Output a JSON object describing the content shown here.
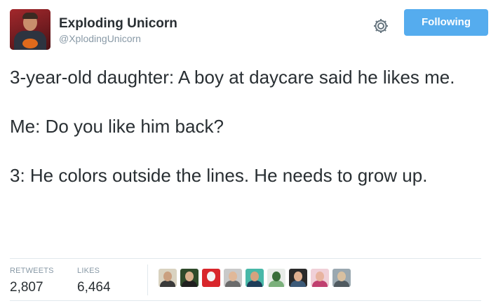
{
  "user": {
    "display_name": "Exploding Unicorn",
    "handle": "@XplodingUnicorn"
  },
  "actions": {
    "follow_label": "Following"
  },
  "tweet": {
    "lines": [
      "3-year-old daughter: A boy at daycare said he likes me.",
      "Me: Do you like him back?",
      "3: He colors outside the lines. He needs to grow up."
    ]
  },
  "stats": {
    "retweets_label": "RETWEETS",
    "retweets_value": "2,807",
    "likes_label": "LIKES",
    "likes_value": "6,464"
  },
  "colors": {
    "follow_button": "#55acee",
    "text": "#292f33",
    "muted": "#8899a6",
    "border": "#e1e8ed"
  },
  "likers": [
    {
      "name": "liker-avatar-1",
      "bg": "#d9d2c0",
      "face": "#caa080",
      "shirt": "#3a3a3a"
    },
    {
      "name": "liker-avatar-2",
      "bg": "#2f4a2a",
      "face": "#d9b08c",
      "shirt": "#1f1f1f"
    },
    {
      "name": "liker-avatar-3",
      "bg": "#d8262b",
      "face": "#f4f4f4",
      "shirt": "#d8262b"
    },
    {
      "name": "liker-avatar-4",
      "bg": "#c9c9c9",
      "face": "#e0b899",
      "shirt": "#6b6b6b"
    },
    {
      "name": "liker-avatar-5",
      "bg": "#48b8a8",
      "face": "#d6a27e",
      "shirt": "#1e3d59"
    },
    {
      "name": "liker-avatar-6",
      "bg": "#e8ece8",
      "face": "#3a6e3a",
      "shirt": "#7bb07b"
    },
    {
      "name": "liker-avatar-7",
      "bg": "#2a2a2a",
      "face": "#e0b090",
      "shirt": "#3c5a78"
    },
    {
      "name": "liker-avatar-8",
      "bg": "#f0d0d8",
      "face": "#e8b4a0",
      "shirt": "#c04070"
    },
    {
      "name": "liker-avatar-9",
      "bg": "#9aa8b0",
      "face": "#d8c0a0",
      "shirt": "#505a60"
    }
  ]
}
